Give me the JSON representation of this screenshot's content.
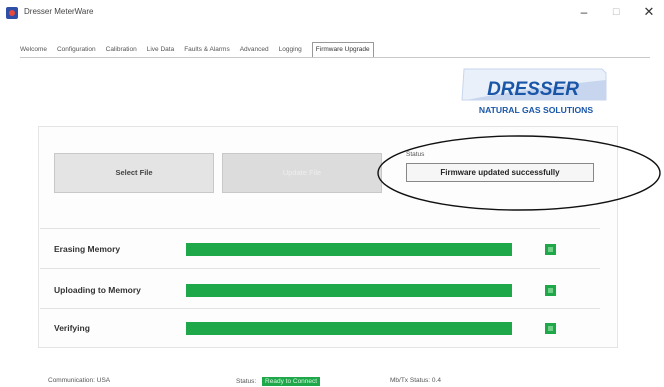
{
  "window": {
    "title": "Dresser MeterWare"
  },
  "tabs": [
    {
      "label": "Welcome",
      "active": false
    },
    {
      "label": "Configuration",
      "active": false
    },
    {
      "label": "Calibration",
      "active": false
    },
    {
      "label": "Live Data",
      "active": false
    },
    {
      "label": "Faults & Alarms",
      "active": false
    },
    {
      "label": "Advanced",
      "active": false
    },
    {
      "label": "Logging",
      "active": false
    },
    {
      "label": "Firmware Upgrade",
      "active": true
    }
  ],
  "logo": {
    "brand": "DRESSER",
    "tagline": "NATURAL GAS SOLUTIONS",
    "color": "#1a56a8"
  },
  "buttons": {
    "select_file": "Select File",
    "update_file": "Update File"
  },
  "status": {
    "label": "Status",
    "value": "Firmware updated successfully"
  },
  "progress": [
    {
      "label": "Erasing Memory",
      "fraction": 1.0,
      "done": true
    },
    {
      "label": "Uploading to Memory",
      "fraction": 1.0,
      "done": true
    },
    {
      "label": "Verifying",
      "fraction": 1.0,
      "done": true
    }
  ],
  "statusbar": {
    "comm_label": "Communication:",
    "comm_value": "USA",
    "status_label": "Status:",
    "status_value": "Ready to Connect",
    "mb_label": "Mb/Tx Status:",
    "mb_value": "0.4"
  },
  "colors": {
    "progress_green": "#1ea84a",
    "logo_blue": "#1a56a8"
  }
}
